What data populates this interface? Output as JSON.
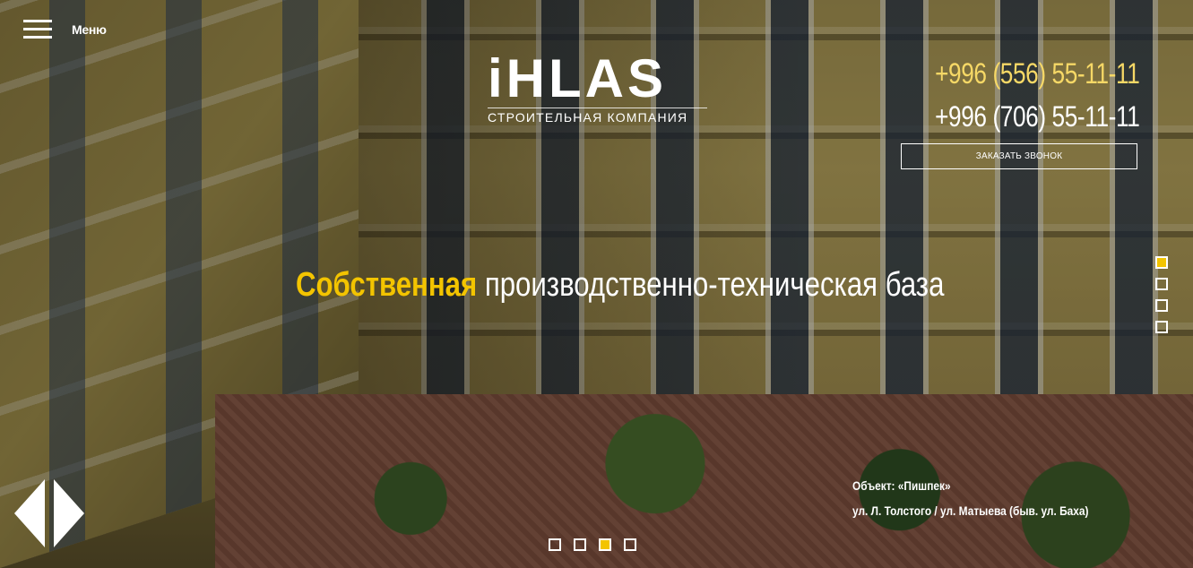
{
  "header": {
    "menu_label": "Меню",
    "logo_text": "iHLAS",
    "logo_subtitle": "СТРОИТЕЛЬНАЯ КОМПАНИЯ",
    "phones": [
      "+996 (556) 55-11-11",
      "+996 (706) 55-11-11"
    ],
    "callback_label": "ЗАКАЗАТЬ ЗВОНОК"
  },
  "slide": {
    "headline_accent": "Собственная",
    "headline_rest": " производственно-техническая база",
    "object_title": "Объект: «Пишпек»",
    "object_address": "ул. Л. Толстого / ул. Матыева (быв. ул. Баха)"
  },
  "slider": {
    "vertical_dots": 4,
    "vertical_active": 1,
    "horizontal_dots": 4,
    "horizontal_active": 3
  },
  "icons": {
    "menu": "hamburger-icon",
    "prev": "arrow-left-icon",
    "next": "arrow-right-icon"
  },
  "colors": {
    "accent": "#f3c400",
    "phone_highlight": "#f6d866",
    "text": "#ffffff"
  }
}
